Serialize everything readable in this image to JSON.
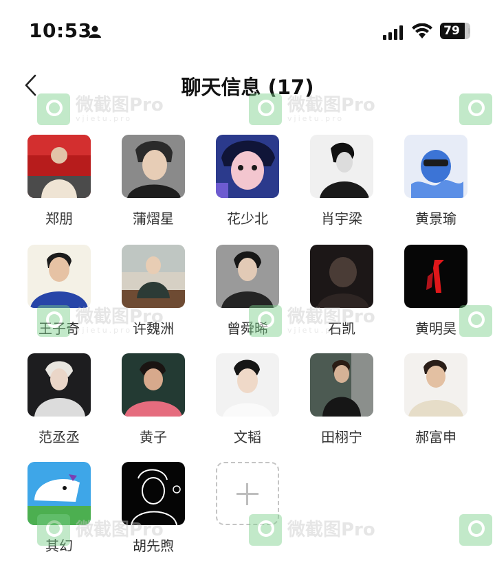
{
  "status_bar": {
    "time": "10:53",
    "battery": "79"
  },
  "header": {
    "title": "聊天信息 (17)"
  },
  "watermark": {
    "text": "微截图Pro",
    "sub": "vjietu.pro"
  },
  "members": [
    {
      "name": "郑朋"
    },
    {
      "name": "蒲熠星"
    },
    {
      "name": "花少北"
    },
    {
      "name": "肖宇梁"
    },
    {
      "name": "黄景瑜"
    },
    {
      "name": "王子奇"
    },
    {
      "name": "许魏洲"
    },
    {
      "name": "曾舜晞"
    },
    {
      "name": "石凯"
    },
    {
      "name": "黄明昊"
    },
    {
      "name": "范丞丞"
    },
    {
      "name": "黄子"
    },
    {
      "name": "文韬"
    },
    {
      "name": "田栩宁"
    },
    {
      "name": "郝富申"
    },
    {
      "name": "其幻"
    },
    {
      "name": "胡先煦"
    }
  ],
  "icons": {
    "back": "chevron-left-icon",
    "add": "plus-icon"
  }
}
